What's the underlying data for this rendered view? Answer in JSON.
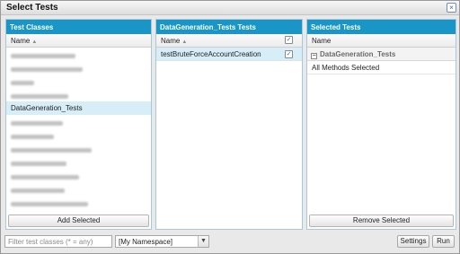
{
  "dialog": {
    "title": "Select Tests",
    "close_symbol": "×"
  },
  "left_panel": {
    "header": "Test Classes",
    "column": "Name",
    "items": [
      {
        "label": "",
        "redacted": true
      },
      {
        "label": "",
        "redacted": true
      },
      {
        "label": "",
        "redacted": true
      },
      {
        "label": "",
        "redacted": true
      },
      {
        "label": "DataGeneration_Tests",
        "selected": true
      },
      {
        "label": "",
        "redacted": true
      },
      {
        "label": "",
        "redacted": true
      },
      {
        "label": "",
        "redacted": true
      },
      {
        "label": "",
        "redacted": true
      },
      {
        "label": "",
        "redacted": true
      },
      {
        "label": "",
        "redacted": true
      },
      {
        "label": "",
        "redacted": true
      }
    ],
    "button": "Add Selected"
  },
  "middle_panel": {
    "header": "DataGeneration_Tests Tests",
    "column": "Name",
    "header_checked": true,
    "items": [
      {
        "label": "testBruteForceAccountCreation",
        "checked": true
      }
    ]
  },
  "right_panel": {
    "header": "Selected Tests",
    "column": "Name",
    "group": "DataGeneration_Tests",
    "group_expander": "−",
    "detail": "All Methods Selected",
    "button": "Remove Selected"
  },
  "bottom": {
    "filter_placeholder": "Filter test classes (* = any)",
    "namespace_value": "[My Namespace]",
    "settings": "Settings",
    "run": "Run"
  },
  "colors": {
    "header_blue": "#1996c6",
    "selection": "#d7edf8"
  }
}
